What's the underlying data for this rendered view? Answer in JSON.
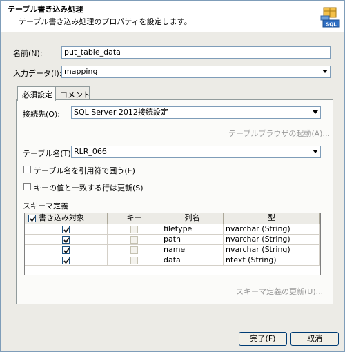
{
  "header": {
    "title": "テーブル書き込み処理",
    "description": "テーブル書き込み処理のプロパティを設定します。",
    "icon_text": "SQL"
  },
  "fields": {
    "name_label": "名前(N):",
    "name_value": "put_table_data",
    "input_label": "入力データ(I):",
    "input_value": "mapping"
  },
  "tabs": [
    {
      "label": "必須設定",
      "active": true
    },
    {
      "label": "コメント",
      "active": false
    }
  ],
  "required": {
    "connection_label": "接続先(O):",
    "connection_value": "SQL Server 2012接続設定",
    "table_browser_link": "テーブルブラウザの起動(A)...",
    "table_name_label": "テーブル名(T):",
    "table_name_value": "RLR_066",
    "quote_table_label": "テーブル名を引用符で囲う(E)",
    "quote_table_checked": false,
    "update_key_label": "キーの値と一致する行は更新(S)",
    "update_key_checked": false,
    "schema_label": "スキーマ定義",
    "schema_update_link": "スキーマ定義の更新(U)..."
  },
  "schema_grid": {
    "columns": [
      "書き込み対象",
      "キー",
      "列名",
      "型"
    ],
    "header_checked": true,
    "rows": [
      {
        "write": true,
        "key": false,
        "name": "filetype",
        "type": "nvarchar (String)"
      },
      {
        "write": true,
        "key": false,
        "name": "path",
        "type": "nvarchar (String)"
      },
      {
        "write": true,
        "key": false,
        "name": "name",
        "type": "nvarchar (String)"
      },
      {
        "write": true,
        "key": false,
        "name": "data",
        "type": "ntext (String)"
      }
    ]
  },
  "buttons": {
    "ok_label": "完了(F)",
    "cancel_label": "取消"
  },
  "colors": {
    "dialog_bg": "#ecebe6",
    "panel_bg": "#fbfbf9",
    "border": "#7f9db9",
    "disabled_text": "#9a9a9a"
  }
}
